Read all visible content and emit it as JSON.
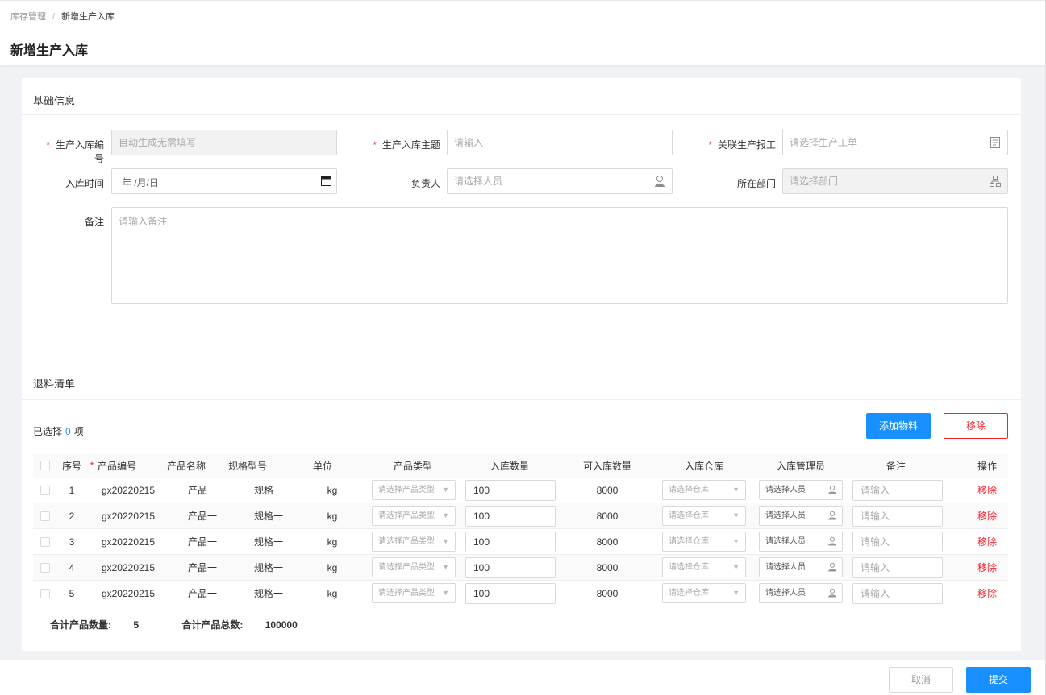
{
  "breadcrumb": {
    "parent": "库存管理",
    "separator": "/",
    "current": "新增生产入库"
  },
  "page_title": "新增生产入库",
  "basic_section": {
    "title": "基础信息",
    "fields": {
      "code": {
        "label": "生产入库编号",
        "required": "*",
        "placeholder": "自动生成无需填写"
      },
      "subject": {
        "label": "生产入库主题",
        "required": "*",
        "placeholder": "请输入"
      },
      "work_order": {
        "label": "关联生产报工",
        "required": "*",
        "placeholder": "请选择生产工单"
      },
      "date": {
        "label": "入库时间",
        "placeholder": "年 /月/日"
      },
      "owner": {
        "label": "负责人",
        "placeholder": "请选择人员"
      },
      "dept": {
        "label": "所在部门",
        "placeholder": "请选择部门"
      },
      "remark": {
        "label": "备注",
        "placeholder": "请输入备注"
      }
    }
  },
  "list_section": {
    "title": "退料清单",
    "selected_prefix": "已选择",
    "selected_count": "0",
    "selected_suffix": "项",
    "add_button": "添加物料",
    "remove_button": "移除"
  },
  "table": {
    "columns": [
      "序号",
      "*",
      "产品编号",
      "产品名称",
      "规格型号",
      "单位",
      "产品类型",
      "入库数量",
      "可入库数量",
      "入库仓库",
      "入库管理员",
      "备注",
      "操作"
    ],
    "rows": [
      {
        "idx": "1",
        "code": "gx20220215",
        "name": "产品一",
        "spec": "规格一",
        "unit": "kg",
        "type_ph": "请选择产品类型",
        "qty": "100",
        "avail": "8000",
        "wh_ph": "请选择仓库",
        "admin": "请选择人员",
        "remark_ph": "请输入",
        "action": "移除"
      },
      {
        "idx": "2",
        "code": "gx20220215",
        "name": "产品一",
        "spec": "规格一",
        "unit": "kg",
        "type_ph": "请选择产品类型",
        "qty": "100",
        "avail": "8000",
        "wh_ph": "请选择仓库",
        "admin": "请选择人员",
        "remark_ph": "请输入",
        "action": "移除"
      },
      {
        "idx": "3",
        "code": "gx20220215",
        "name": "产品一",
        "spec": "规格一",
        "unit": "kg",
        "type_ph": "请选择产品类型",
        "qty": "100",
        "avail": "8000",
        "wh_ph": "请选择仓库",
        "admin": "请选择人员",
        "remark_ph": "请输入",
        "action": "移除"
      },
      {
        "idx": "4",
        "code": "gx20220215",
        "name": "产品一",
        "spec": "规格一",
        "unit": "kg",
        "type_ph": "请选择产品类型",
        "qty": "100",
        "avail": "8000",
        "wh_ph": "请选择仓库",
        "admin": "请选择人员",
        "remark_ph": "请输入",
        "action": "移除"
      },
      {
        "idx": "5",
        "code": "gx20220215",
        "name": "产品一",
        "spec": "规格一",
        "unit": "kg",
        "type_ph": "请选择产品类型",
        "qty": "100",
        "avail": "8000",
        "wh_ph": "请选择仓库",
        "admin": "请选择人员",
        "remark_ph": "请输入",
        "action": "移除"
      }
    ]
  },
  "summary": {
    "count_label": "合计产品数量:",
    "count_value": "5",
    "total_label": "合计产品总数:",
    "total_value": "100000"
  },
  "footer": {
    "cancel": "取消",
    "submit": "提交"
  },
  "colors": {
    "primary": "#1890ff",
    "danger": "#f5222d",
    "required": "#f5222d"
  }
}
